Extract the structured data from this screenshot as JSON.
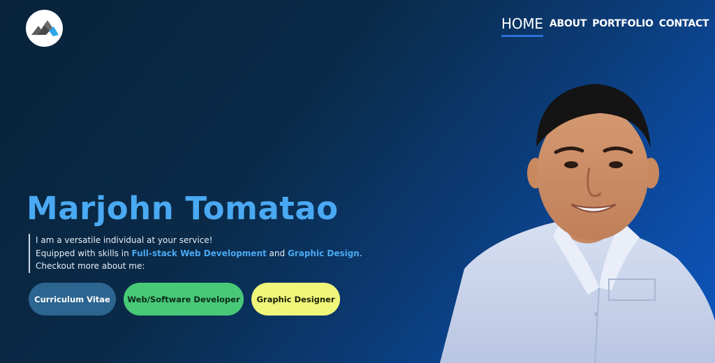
{
  "nav": {
    "items": [
      {
        "label": "HOME",
        "active": true
      },
      {
        "label": "ABOUT"
      },
      {
        "label": "PORTFOLIO"
      },
      {
        "label": "CONTACT"
      }
    ]
  },
  "hero": {
    "name": "Marjohn Tomatao",
    "intro_line1": "I am a versatile individual at your service!",
    "intro_line2_prefix": "Equipped with skills in ",
    "skill1": "Full-stack Web Development",
    "intro_line2_middle": " and ",
    "skill2": "Graphic Design",
    "intro_line2_suffix": ".",
    "intro_line3": "Checkout more about me:"
  },
  "buttons": {
    "cv": "Curriculum Vitae",
    "developer": "Web/Software Developer",
    "designer": "Graphic Designer"
  },
  "colors": {
    "accent": "#4aa9f2",
    "cv_button": "#2b6590",
    "developer_button": "#48c978",
    "designer_button": "#eff67a",
    "nav_underline": "#2f6fd8"
  },
  "icons": {
    "logo": "mountain-logo-icon"
  }
}
